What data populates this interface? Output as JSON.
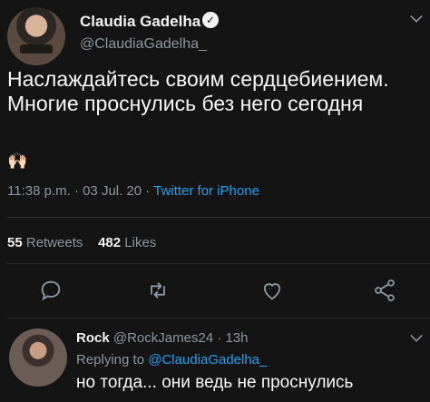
{
  "author": {
    "name": "Claudia Gadelha",
    "handle": "@ClaudiaGadelha_"
  },
  "tweet": {
    "text": "Наслаждайтесь своим сердцебиением. Многие проснулись без него сегодня",
    "emoji": "🙌🏻",
    "time": "11:38 p.m. · 03 Jul. 20 · ",
    "source": "Twitter for iPhone"
  },
  "stats": {
    "retweets_count": "55",
    "retweets_label": "Retweets",
    "likes_count": "482",
    "likes_label": "Likes"
  },
  "actions": [
    "reply-icon",
    "retweet-icon",
    "like-icon",
    "share-icon"
  ],
  "reply": {
    "name": "Rock",
    "handle_time": "@RockJames24 · 13h",
    "replying_prefix": "Replying to ",
    "replying_to": "@ClaudiaGadelha_",
    "text": "но тогда... они ведь не проснулись"
  },
  "colors": {
    "background": "#141414",
    "link": "#1da1f2",
    "muted": "#8b96a1"
  }
}
